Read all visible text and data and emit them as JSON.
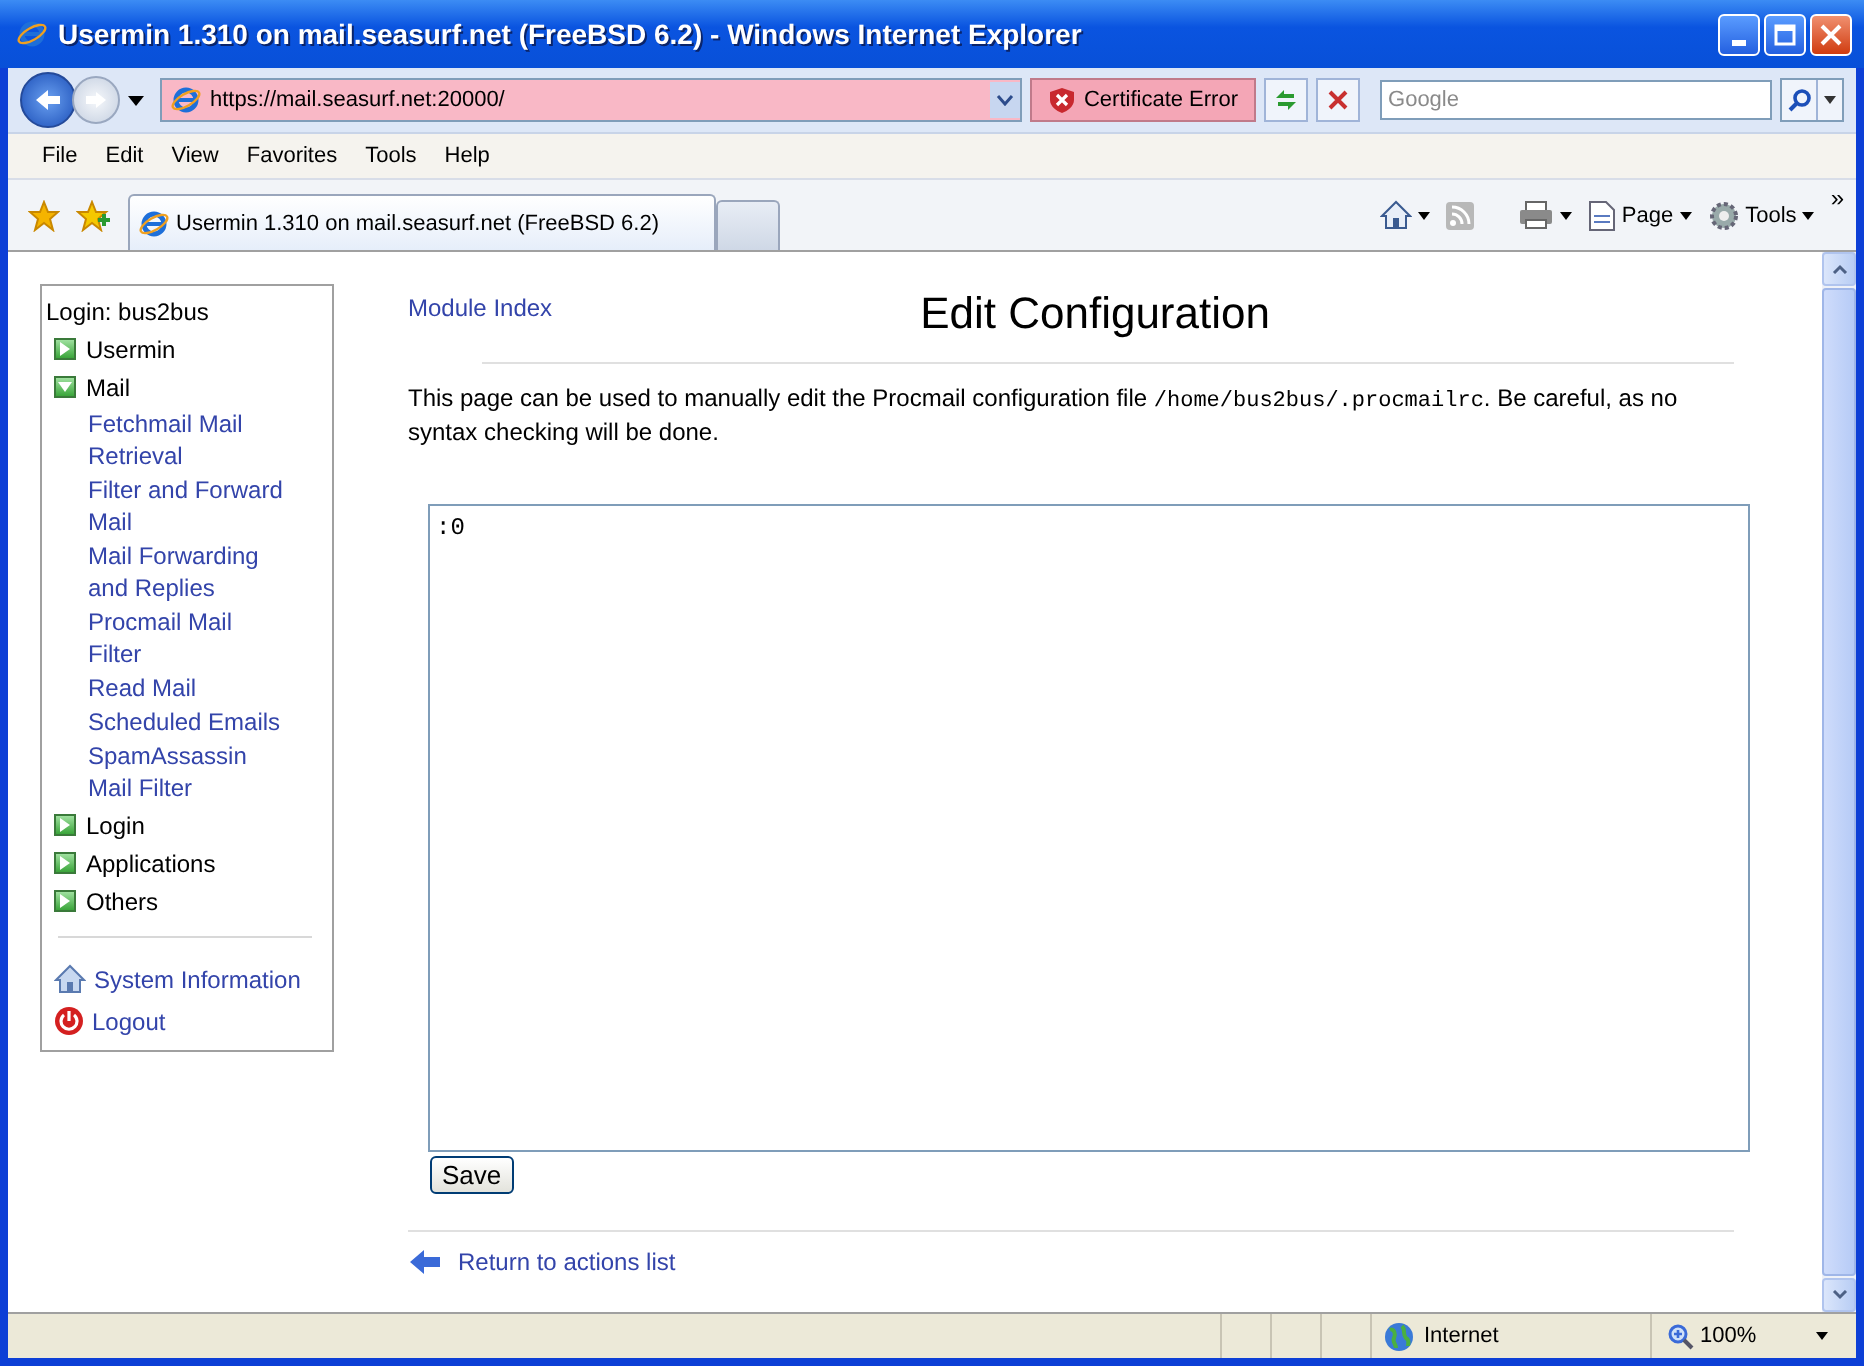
{
  "window": {
    "title": "Usermin 1.310 on mail.seasurf.net (FreeBSD 6.2) - Windows Internet Explorer"
  },
  "address_bar": {
    "url": "https://mail.seasurf.net:20000/",
    "certificate_error": "Certificate Error"
  },
  "search": {
    "placeholder": "Google"
  },
  "menu": [
    "File",
    "Edit",
    "View",
    "Favorites",
    "Tools",
    "Help"
  ],
  "tabs": [
    {
      "label": "Usermin 1.310 on mail.seasurf.net (FreeBSD 6.2)",
      "selected": true
    }
  ],
  "command_bar": {
    "page": "Page",
    "tools": "Tools",
    "overflow": "»"
  },
  "sidebar": {
    "login": "Login: bus2bus",
    "categories": [
      {
        "label": "Usermin",
        "expanded": false
      },
      {
        "label": "Mail",
        "expanded": true,
        "children": [
          "Fetchmail Mail Retrieval",
          "Filter and Forward Mail",
          "Mail Forwarding and Replies",
          "Procmail Mail Filter",
          "Read Mail",
          "Scheduled Emails",
          "SpamAssassin Mail Filter"
        ]
      },
      {
        "label": "Login",
        "expanded": false
      },
      {
        "label": "Applications",
        "expanded": false
      },
      {
        "label": "Others",
        "expanded": false
      }
    ],
    "links": [
      {
        "kind": "system",
        "label": "System Information"
      },
      {
        "kind": "logout",
        "label": "Logout"
      }
    ]
  },
  "page": {
    "module_index": "Module Index",
    "title": "Edit Configuration",
    "description": [
      {
        "kind": "plain",
        "text": "This page can be used to manually edit the Procmail configuration file "
      },
      {
        "kind": "code",
        "text": "/home/bus2bus/.procmailrc"
      },
      {
        "kind": "plain",
        "text": ". Be careful, as no syntax checking will be done."
      }
    ],
    "editor": {
      "value": ":0"
    },
    "save": "Save",
    "return_link": "Return to actions list"
  },
  "status_bar": {
    "zone": "Internet",
    "zoom": "100%"
  }
}
